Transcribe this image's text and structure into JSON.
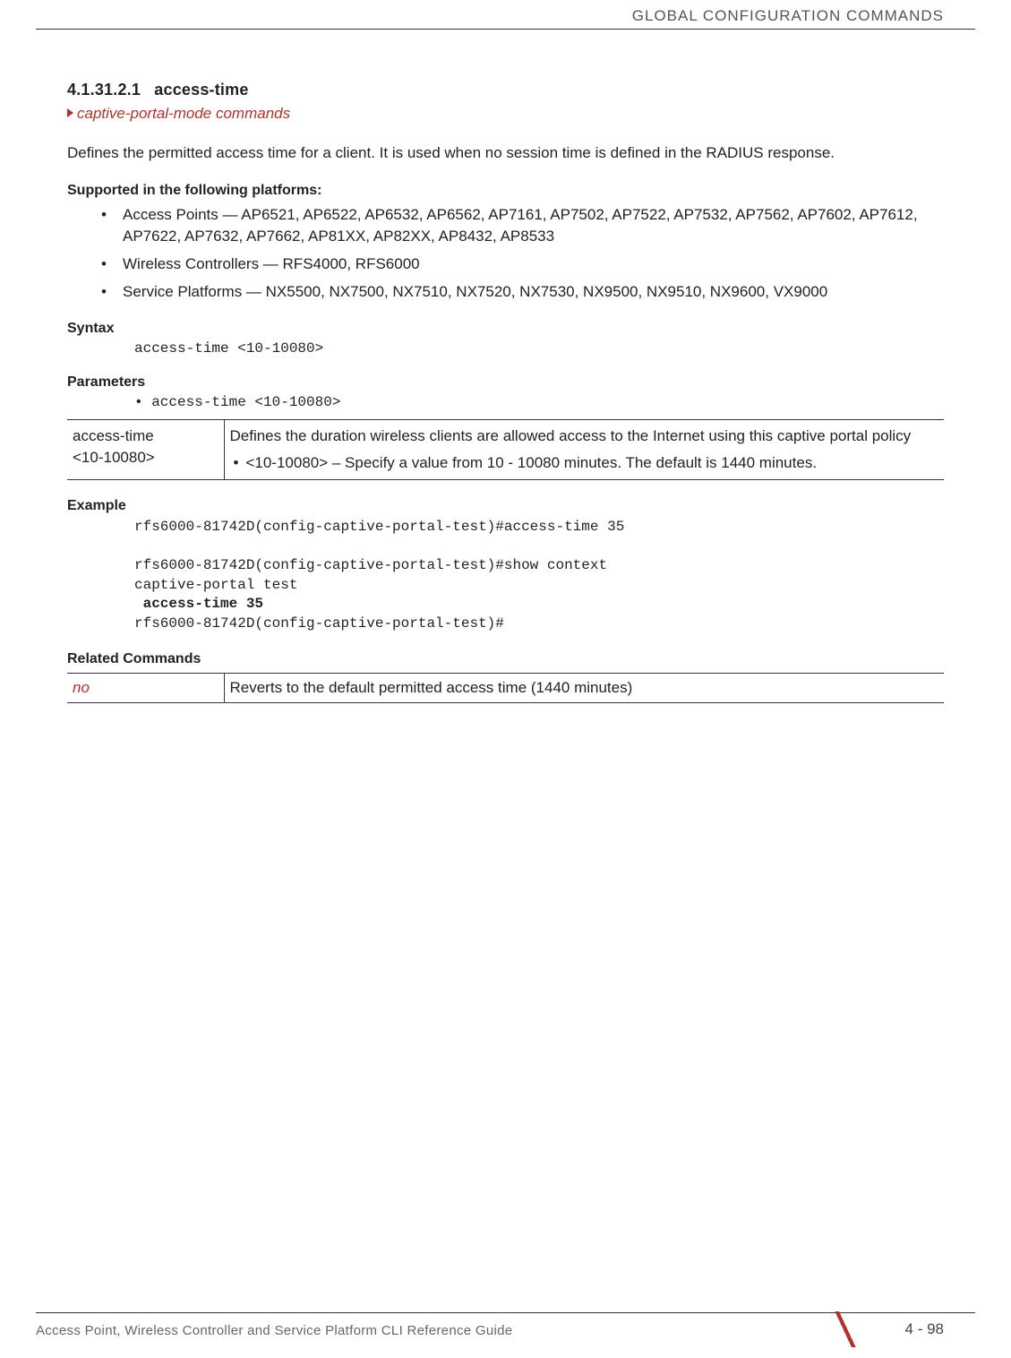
{
  "running_header": "GLOBAL CONFIGURATION COMMANDS",
  "section": {
    "number": "4.1.31.2.1",
    "title": "access-time",
    "breadcrumb": "captive-portal-mode commands"
  },
  "intro": "Defines the permitted access time for a client. It is used when no session time is defined in the RADIUS response.",
  "supported": {
    "heading": "Supported in the following platforms:",
    "items": [
      "Access Points — AP6521, AP6522, AP6532, AP6562, AP7161, AP7502, AP7522, AP7532, AP7562, AP7602, AP7612, AP7622, AP7632, AP7662, AP81XX, AP82XX, AP8432, AP8533",
      "Wireless Controllers — RFS4000, RFS6000",
      "Service Platforms — NX5500, NX7500, NX7510, NX7520, NX7530, NX9500, NX9510, NX9600, VX9000"
    ]
  },
  "syntax": {
    "heading": "Syntax",
    "code": "access-time <10-10080>"
  },
  "parameters": {
    "heading": "Parameters",
    "bullet": "• access-time <10-10080>",
    "table": {
      "cell_a": "access-time\n<10-10080>",
      "cell_b_line1": "Defines the duration wireless clients are allowed access to the Internet using this captive portal policy",
      "cell_b_bullet": "<10-10080> – Specify a value from 10 - 10080 minutes. The default is 1440 minutes."
    }
  },
  "example": {
    "heading": "Example",
    "line1": "rfs6000-81742D(config-captive-portal-test)#access-time 35",
    "line2": "rfs6000-81742D(config-captive-portal-test)#show context",
    "line3": "captive-portal test",
    "line4_bold": " access-time 35",
    "line5": "rfs6000-81742D(config-captive-portal-test)#"
  },
  "related": {
    "heading": "Related Commands",
    "cmd": "no",
    "desc": "Reverts to the default permitted access time (1440 minutes)"
  },
  "footer": {
    "title": "Access Point, Wireless Controller and Service Platform CLI Reference Guide",
    "page": "4 - 98"
  }
}
